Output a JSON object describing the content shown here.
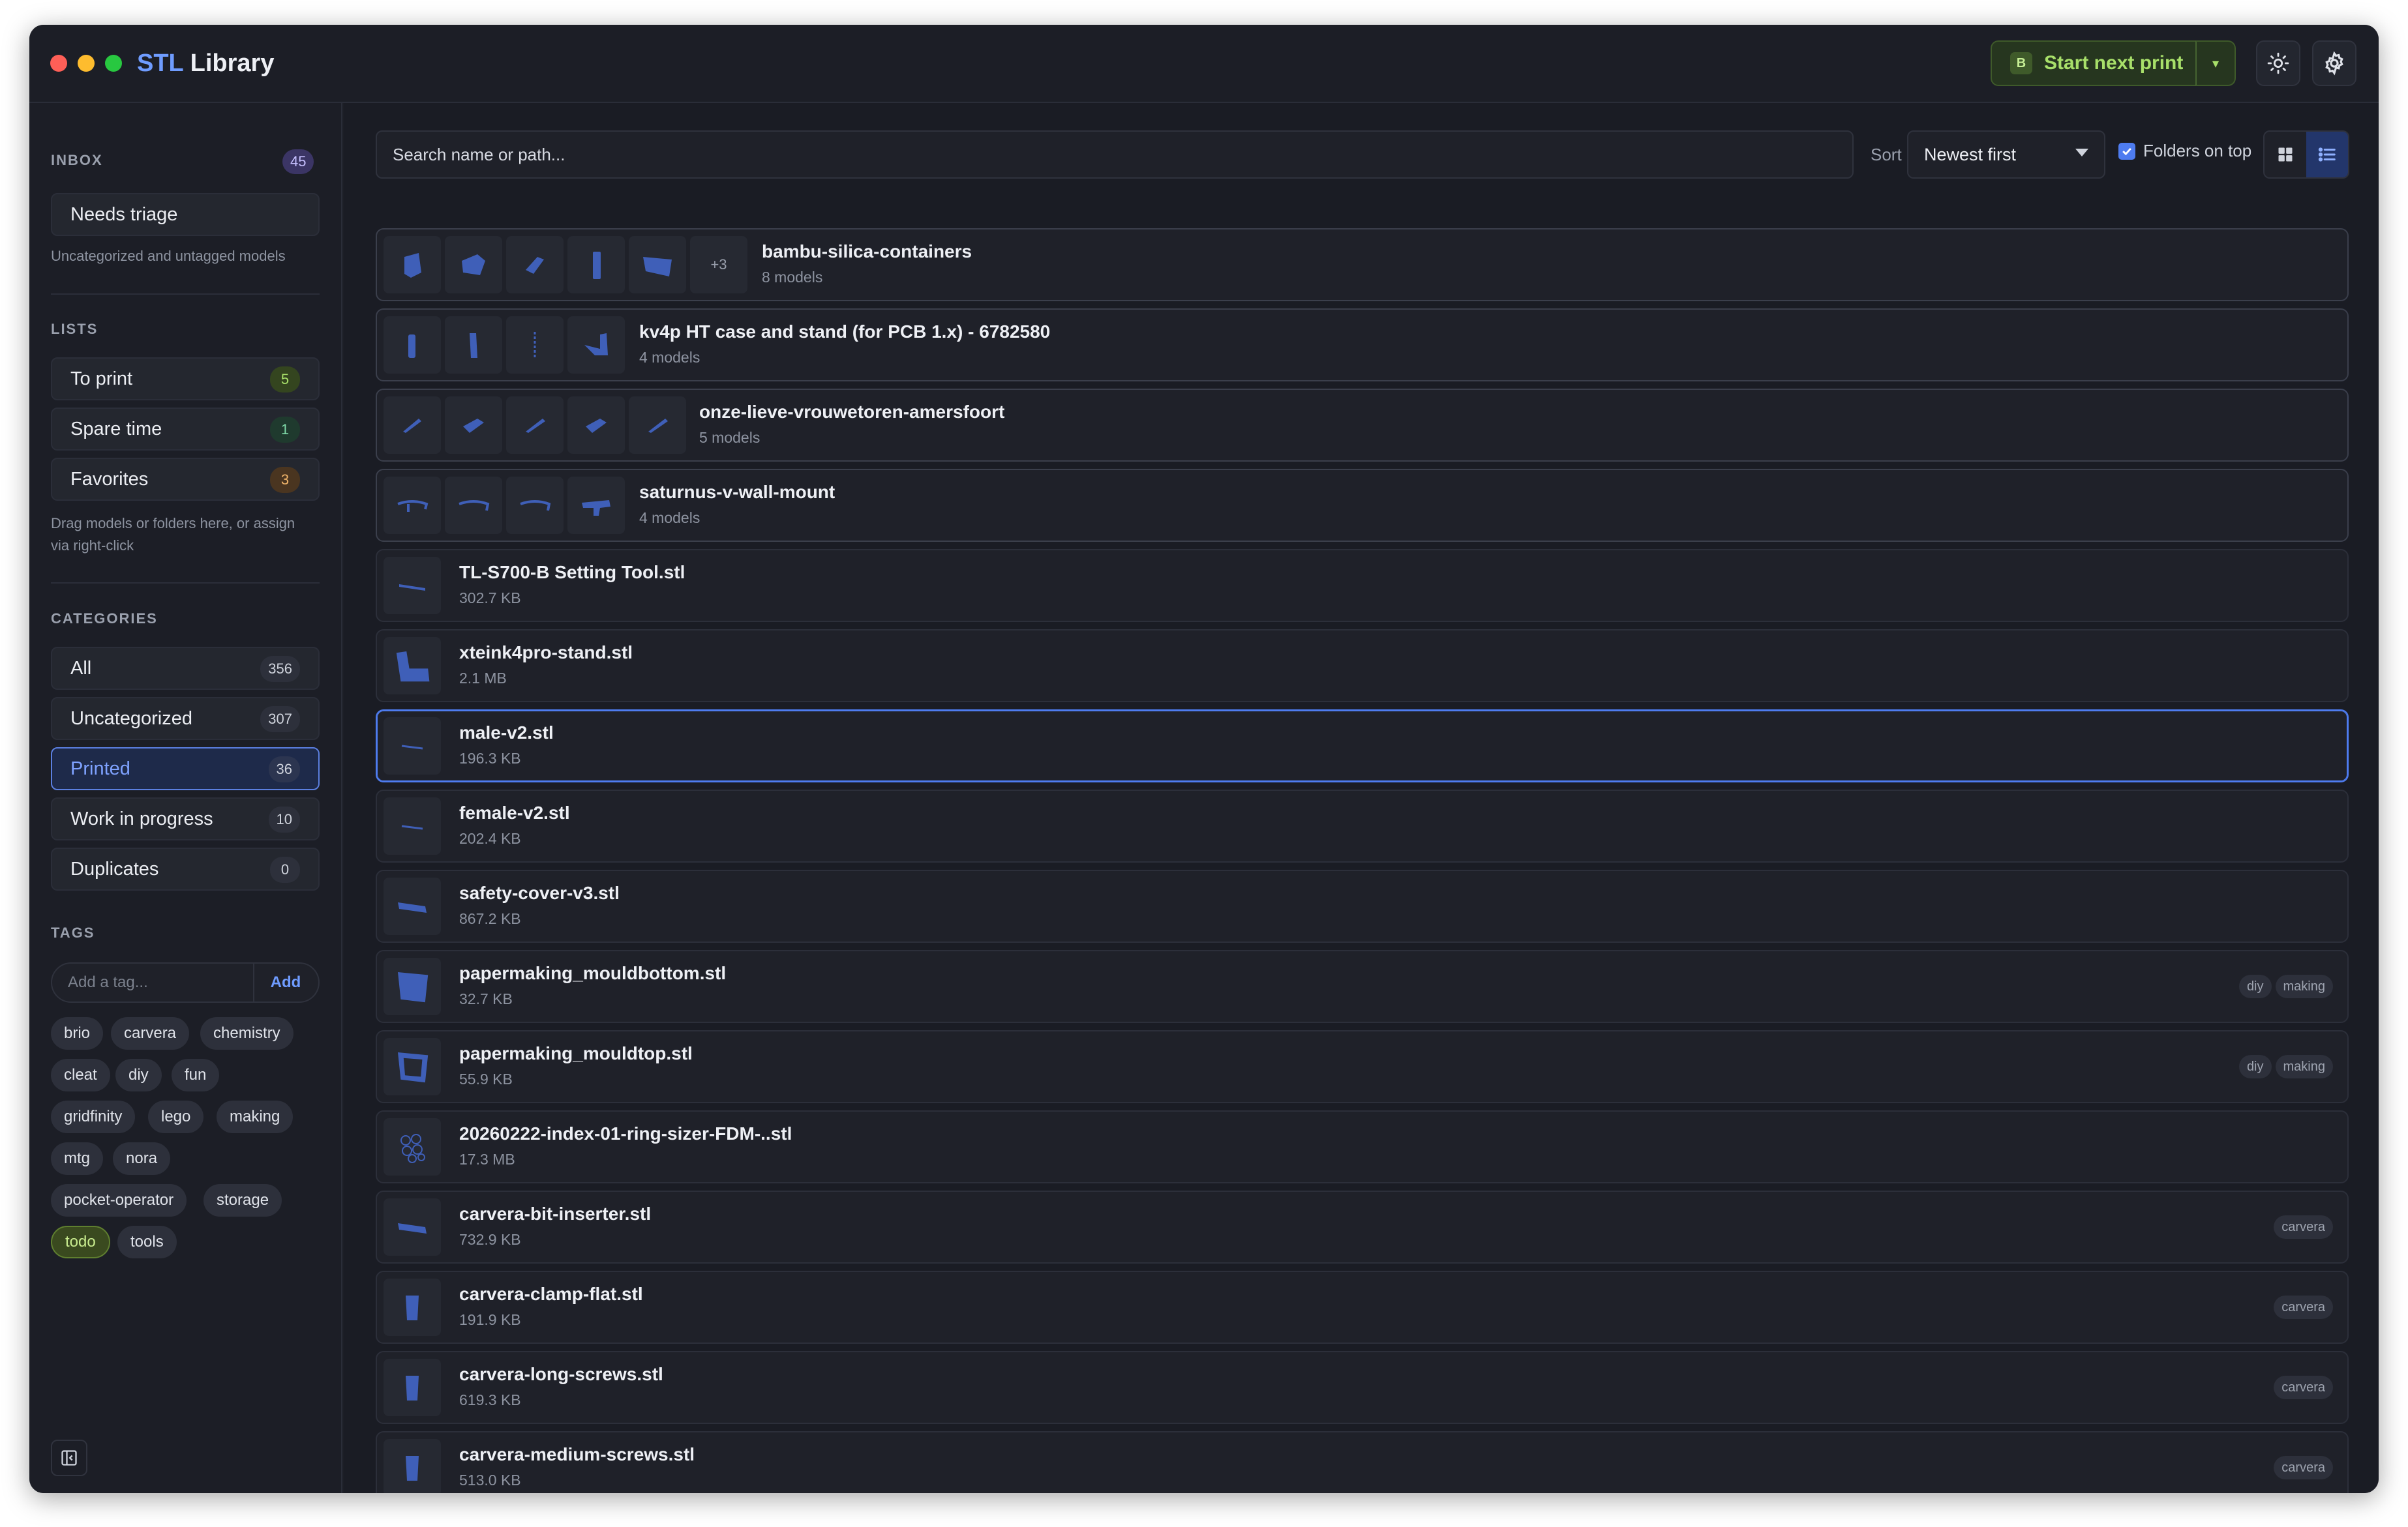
{
  "app": {
    "title_accent": "STL",
    "title_rest": " Library"
  },
  "header": {
    "start_label": "Start next print",
    "start_badge": "B"
  },
  "sidebar": {
    "inbox_label": "INBOX",
    "inbox_count": "45",
    "needs_triage": "Needs triage",
    "inbox_note": "Uncategorized and untagged models",
    "lists_label": "LISTS",
    "lists": [
      {
        "label": "To print",
        "count": "5"
      },
      {
        "label": "Spare time",
        "count": "1"
      },
      {
        "label": "Favorites",
        "count": "3"
      }
    ],
    "lists_note": "Drag models or folders here, or assign via right-click",
    "categories_label": "CATEGORIES",
    "categories": [
      {
        "label": "All",
        "count": "356"
      },
      {
        "label": "Uncategorized",
        "count": "307"
      },
      {
        "label": "Printed",
        "count": "36"
      },
      {
        "label": "Work in progress",
        "count": "10"
      },
      {
        "label": "Duplicates",
        "count": "0"
      }
    ],
    "tags_label": "TAGS",
    "tag_placeholder": "Add a tag...",
    "tag_add": "Add",
    "tags": [
      "brio",
      "carvera",
      "chemistry",
      "cleat",
      "diy",
      "fun",
      "gridfinity",
      "lego",
      "making",
      "mtg",
      "nora",
      "pocket-operator",
      "storage",
      "todo",
      "tools"
    ]
  },
  "toolbar": {
    "search_placeholder": "Search name or path...",
    "sort_label": "Sort",
    "sort_value": "Newest first",
    "folders_on_top": "Folders on top"
  },
  "rows": [
    {
      "name": "bambu-silica-containers",
      "sub": "8 models",
      "more": "+3",
      "tags": []
    },
    {
      "name": "kv4p HT case and stand (for PCB 1.x) - 6782580",
      "sub": "4 models",
      "tags": []
    },
    {
      "name": "onze-lieve-vrouwetoren-amersfoort",
      "sub": "5 models",
      "tags": []
    },
    {
      "name": "saturnus-v-wall-mount",
      "sub": "4 models",
      "tags": []
    },
    {
      "name": "TL-S700-B Setting Tool.stl",
      "sub": "302.7 KB",
      "tags": []
    },
    {
      "name": "xteink4pro-stand.stl",
      "sub": "2.1 MB",
      "tags": []
    },
    {
      "name": "male-v2.stl",
      "sub": "196.3 KB",
      "tags": []
    },
    {
      "name": "female-v2.stl",
      "sub": "202.4 KB",
      "tags": []
    },
    {
      "name": "safety-cover-v3.stl",
      "sub": "867.2 KB",
      "tags": []
    },
    {
      "name": "papermaking_mouldbottom.stl",
      "sub": "32.7 KB",
      "tags": [
        "diy",
        "making"
      ]
    },
    {
      "name": "papermaking_mouldtop.stl",
      "sub": "55.9 KB",
      "tags": [
        "diy",
        "making"
      ]
    },
    {
      "name": "20260222-index-01-ring-sizer-FDM-..stl",
      "sub": "17.3 MB",
      "tags": []
    },
    {
      "name": "carvera-bit-inserter.stl",
      "sub": "732.9 KB",
      "tags": [
        "carvera"
      ]
    },
    {
      "name": "carvera-clamp-flat.stl",
      "sub": "191.9 KB",
      "tags": [
        "carvera"
      ]
    },
    {
      "name": "carvera-long-screws.stl",
      "sub": "619.3 KB",
      "tags": [
        "carvera"
      ]
    },
    {
      "name": "carvera-medium-screws.stl",
      "sub": "513.0 KB",
      "tags": [
        "carvera"
      ]
    }
  ],
  "colors": {
    "accent": "#4e7cf0",
    "model_blue": "#3f5fb8",
    "start_green": "#a8e06a"
  }
}
